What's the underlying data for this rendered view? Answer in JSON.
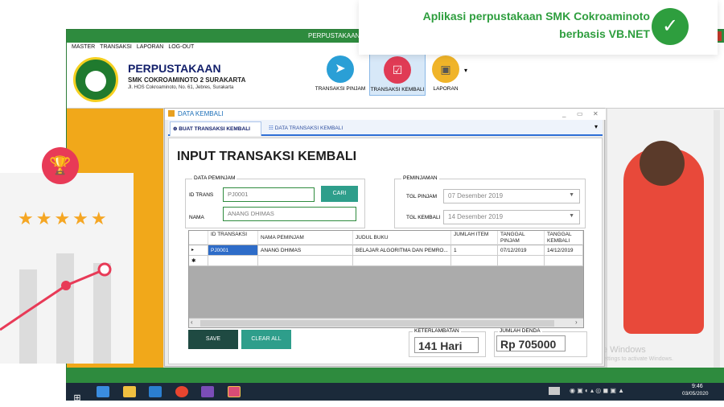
{
  "promo": {
    "line1": "Aplikasi perpustakaan SMK Cokroaminoto",
    "line2": "berbasis VB.NET",
    "accent": "#2e9e3e"
  },
  "left_card": {
    "stars": "★★★★★",
    "star_color": "#f5a623"
  },
  "window": {
    "title": "PERPUSTAKAAN",
    "menu": [
      "MASTER",
      "TRANSAKSI",
      "LAPORAN",
      "LOG-OUT"
    ]
  },
  "header": {
    "app_name": "PERPUSTAKAAN",
    "school": "SMK COKROAMINOTO 2 SURAKARTA",
    "address": "Jl. HOS Cokroaminoto, No. 61, Jebres, Surakarta",
    "toolbar": {
      "pinjam": "TRANSAKSI PINJAM",
      "kembali": "TRANSAKSI KEMBALI",
      "laporan": "LAPORAN"
    }
  },
  "dialog": {
    "title": "DATA KEMBALI",
    "tab_buat": "BUAT TRANSAKSI KEMBALI",
    "tab_data": "DATA TRANSAKSI KEMBALI",
    "heading": "INPUT TRANSAKSI KEMBALI",
    "peminjam": {
      "group": "DATA PEMINJAM",
      "id_label": "ID TRANS",
      "id_value": "PJ0001",
      "cari": "CARI",
      "nama_label": "NAMA",
      "nama_value": "ANANG DHIMAS"
    },
    "peminjaman": {
      "group": "PEMINJAMAN",
      "tgl_pinjam_label": "TGL PINJAM",
      "tgl_pinjam_value": "07 Desember 2019",
      "tgl_kembali_label": "TGL KEMBALI",
      "tgl_kembali_value": "14 Desember 2019"
    },
    "grid": {
      "columns": [
        "ID TRANSAKSI",
        "NAMA PEMINJAM",
        "JUDUL BUKU",
        "JUMLAH ITEM",
        "TANGGAL PINJAM",
        "TANGGAL KEMBALI"
      ],
      "rows": [
        [
          "PJ0001",
          "ANANG DHIMAS",
          "BELAJAR ALGORITMA DAN PEMRO...",
          "1",
          "07/12/2019",
          "14/12/2019"
        ]
      ]
    },
    "save": "SAVE",
    "clear": "CLEAR ALL",
    "keterlambatan_label": "KETERLAMBATAN",
    "keterlambatan_value": "141 Hari",
    "denda_label": "JUMLAH DENDA",
    "denda_value": "Rp 705000"
  },
  "watermark": {
    "line1": "Activate Windows",
    "line2": "Go to PC settings to activate Windows."
  },
  "taskbar": {
    "time": "9:46",
    "date": "03/05/2020"
  }
}
